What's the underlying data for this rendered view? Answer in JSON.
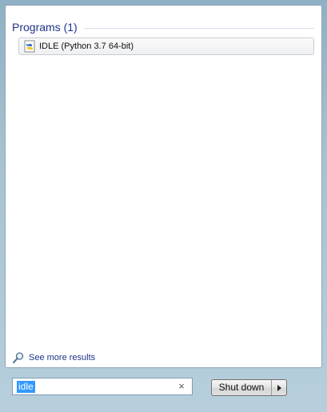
{
  "results": {
    "group_title": "Programs (1)",
    "items": [
      {
        "label": "IDLE (Python 3.7 64-bit)",
        "icon": "python-idle-icon"
      }
    ],
    "see_more_label": "See more results"
  },
  "search": {
    "value": "idle",
    "clear_glyph": "×"
  },
  "power": {
    "label": "Shut down"
  },
  "colors": {
    "header_text": "#1e3287",
    "selection": "#3399ff"
  }
}
